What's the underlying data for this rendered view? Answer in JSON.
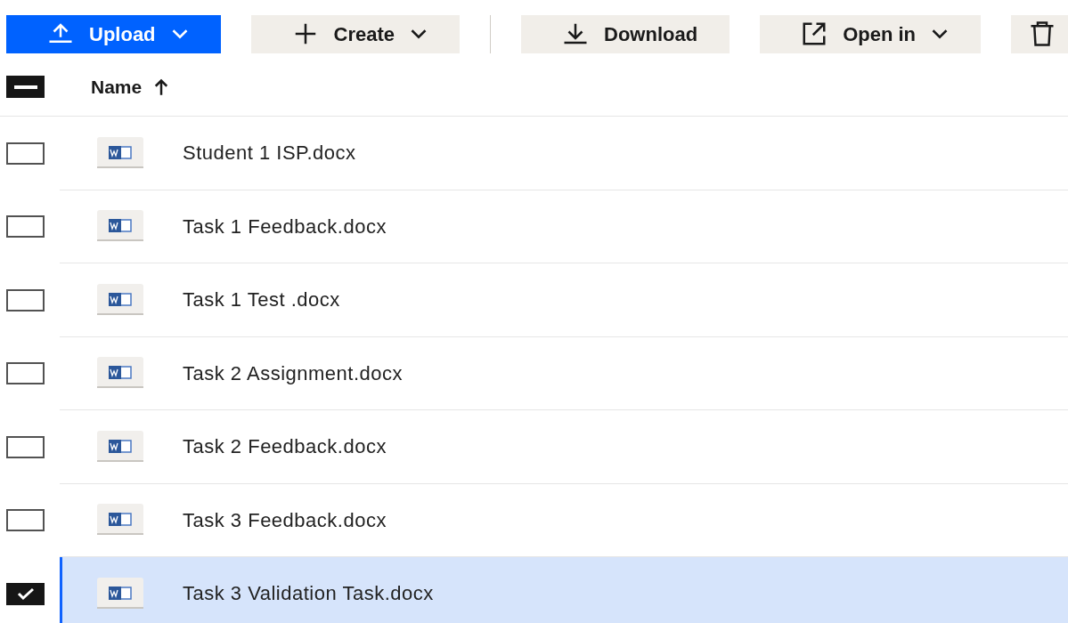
{
  "toolbar": {
    "buttons": [
      {
        "label": "Upload",
        "kind": "primary",
        "has_menu": true
      },
      {
        "label": "Create",
        "kind": "secondary",
        "has_menu": true
      },
      {
        "kind": "divider"
      },
      {
        "label": "Download",
        "kind": "secondary",
        "has_menu": false
      },
      {
        "label": "Open in",
        "kind": "secondary",
        "has_menu": true
      },
      {
        "kind": "secondary",
        "has_menu": false
      }
    ]
  },
  "table": {
    "select_all": {
      "indeterminate": true
    },
    "columns": [
      {
        "label": "Name",
        "sorted_ascending": true
      }
    ],
    "rows": [
      {
        "name": "Student 1 ISP.docx",
        "selected": false
      },
      {
        "name": "Task 1 Feedback.docx",
        "selected": false
      },
      {
        "name": "Task 1 Test .docx",
        "selected": false
      },
      {
        "name": "Task 2 Assignment.docx",
        "selected": false
      },
      {
        "name": "Task 2 Feedback.docx",
        "selected": false
      },
      {
        "name": "Task 3 Feedback.docx",
        "selected": false
      },
      {
        "name": "Task 3 Validation Task.docx",
        "selected": true
      }
    ]
  }
}
